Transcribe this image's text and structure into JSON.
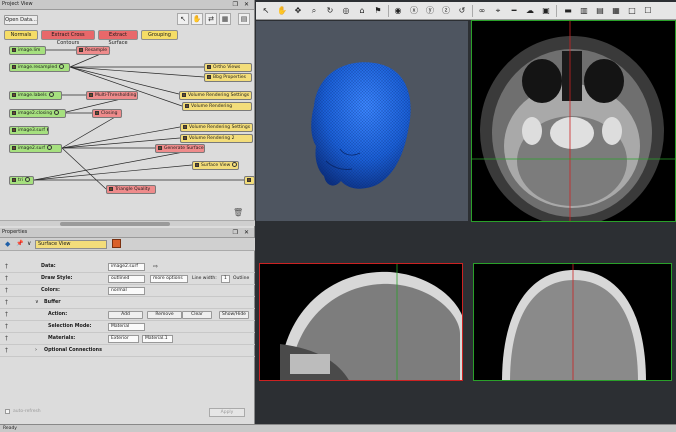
{
  "project_view": {
    "title": "Project View",
    "title_controls": "❐ ✕",
    "open_data_label": "Open Data...",
    "categories": [
      "Normals",
      "Extract Cross Contours",
      "Extract Surface",
      "Grouping"
    ],
    "nodes": {
      "image_lim": "image.lim",
      "resample": "Resample",
      "image_resampled": "image.resampled",
      "ortho_views": "Ortho Views",
      "bbg_properties": "Bbg Properties",
      "image_labels": "image.labels",
      "multi_thresholding": "Multi-Thresholding",
      "volume_rendering_settings": "Volume Rendering Settings",
      "volume_rendering": "Volume Rendering",
      "image2_closing": "image2.closing",
      "closing": "Closing",
      "volume_rendering_settings_2": "Volume Rendering Settings",
      "image3_surf": "image3.surf",
      "volume_rendering_2": "Volume Rendering 2",
      "image2_surf": "image2.surf",
      "generate_surface": "Generate Surface",
      "surface_view": "Surface View",
      "tri": "tri",
      "triangle_quality": "Triangle Quality"
    }
  },
  "properties": {
    "title": "Properties",
    "title_controls": "❐ ✕",
    "node_name": "Surface View",
    "rows": {
      "data_label": "Data:",
      "data_value": "image2.surf",
      "draw_style_label": "Draw Style:",
      "draw_style_value": "outlined",
      "more_options": "more options",
      "line_width_label": "Line width:",
      "line_width_value": "1",
      "outline_label": "Outline",
      "colors_label": "Colors:",
      "colors_value": "normal",
      "buffer_label": "Buffer",
      "action_label": "Action:",
      "add": "Add",
      "remove": "Remove",
      "clear": "Clear",
      "show_hide": "Show/Hide",
      "selection_mode_label": "Selection Mode:",
      "selection_mode_value": "Material",
      "materials_label": "Materials:",
      "materials_value_1": "Exterior",
      "materials_value_2": "Material.1",
      "optional_connections_label": "Optional Connections"
    },
    "auto_refresh_label": "auto-refresh",
    "apply_label": "Apply"
  },
  "status": {
    "text": "Ready"
  },
  "colors": {
    "accent_green": "#2aa02a",
    "accent_red": "#cc2222",
    "surface_blue": "#1a5fd6"
  }
}
